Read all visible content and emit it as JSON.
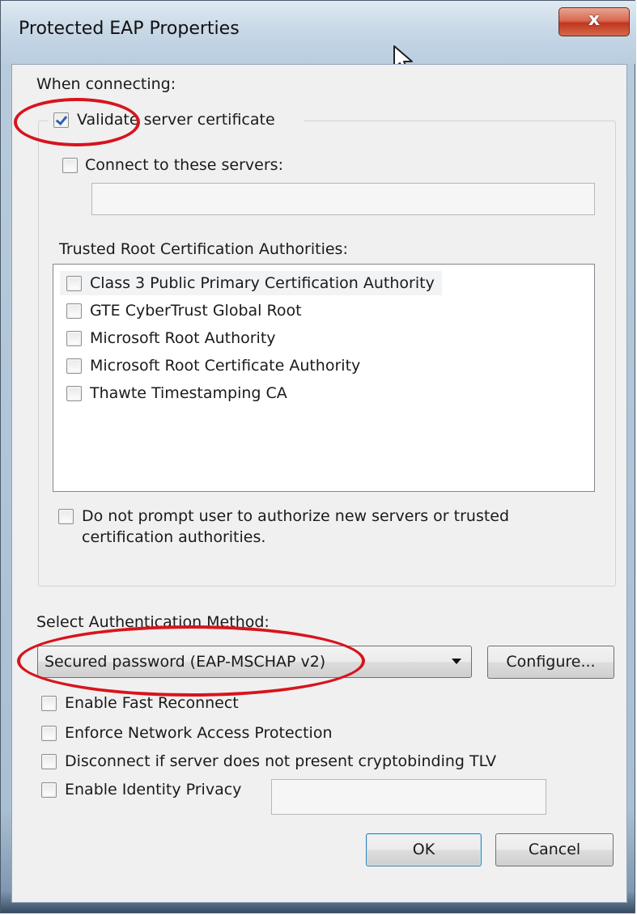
{
  "window": {
    "title": "Protected EAP Properties",
    "close_label": "x"
  },
  "connecting": {
    "heading": "When connecting:",
    "validate_label": "Validate server certificate",
    "validate_checked": true,
    "connect_servers_label": "Connect to these servers:",
    "connect_servers_value": "",
    "trusted_label": "Trusted Root Certification Authorities:",
    "authorities": [
      {
        "label": "Class 3 Public Primary Certification Authority",
        "checked": false
      },
      {
        "label": "GTE CyberTrust Global Root",
        "checked": false
      },
      {
        "label": "Microsoft Root Authority",
        "checked": false
      },
      {
        "label": "Microsoft Root Certificate Authority",
        "checked": false
      },
      {
        "label": "Thawte Timestamping CA",
        "checked": false
      }
    ],
    "do_not_prompt_line1": "Do not prompt user to authorize new servers or trusted",
    "do_not_prompt_line2": "certification authorities."
  },
  "auth": {
    "heading": "Select Authentication Method:",
    "method_value": "Secured password (EAP-MSCHAP v2)",
    "configure_label": "Configure...",
    "options": [
      {
        "label": "Enable Fast Reconnect",
        "checked": false
      },
      {
        "label": "Enforce Network Access Protection",
        "checked": false
      },
      {
        "label": "Disconnect if server does not present cryptobinding TLV",
        "checked": false
      },
      {
        "label": "Enable Identity Privacy",
        "checked": false
      }
    ],
    "identity_value": ""
  },
  "footer": {
    "ok_label": "OK",
    "cancel_label": "Cancel"
  },
  "colors": {
    "annotation": "#d8141c",
    "check": "#2f5fb5"
  }
}
